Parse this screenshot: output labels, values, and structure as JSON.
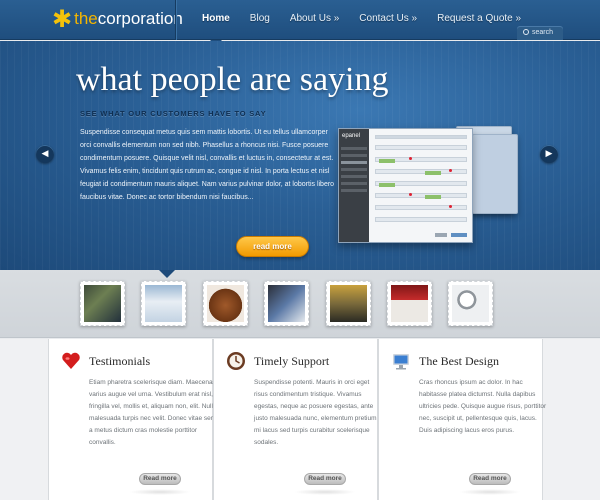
{
  "header": {
    "logo": {
      "prefix": "the",
      "name": "corporation",
      "mark_icon": "star-icon"
    },
    "nav": [
      {
        "label": "Home",
        "active": true
      },
      {
        "label": "Blog",
        "active": false
      },
      {
        "label": "About Us »",
        "active": false
      },
      {
        "label": "Contact Us »",
        "active": false
      },
      {
        "label": "Request a Quote »",
        "active": false
      }
    ],
    "search_label": "search"
  },
  "hero": {
    "title": "what people are saying",
    "subtitle": "SEE WHAT OUR CUSTOMERS HAVE TO SAY",
    "body": "Suspendisse consequat metus quis sem mattis lobortis. Ut eu tellus ullamcorper orci convallis elementum non sed nibh. Phasellus a rhoncus nisi. Fusce posuere condimentum posuere. Quisque velit nisl, convallis et luctus in, consectetur at est. Vivamus felis enim, tincidunt quis rutrum ac, congue id nisl. In porta lectus et nisl feugiat id condimentum mauris aliquet. Nam varius pulvinar dolor, at lobortis libero faucibus vitae. Donec ac tortor bibendum nisi faucibus...",
    "read_more": "read more",
    "prev_icon": "chevron-left-icon",
    "next_icon": "chevron-right-icon",
    "mockup_brand": "epanel"
  },
  "thumbnails": [
    {
      "name": "dark-dashboard"
    },
    {
      "name": "blue-website"
    },
    {
      "name": "briefcase"
    },
    {
      "name": "web-layout"
    },
    {
      "name": "people-walking"
    },
    {
      "name": "red-website"
    },
    {
      "name": "magnifier"
    }
  ],
  "columns": [
    {
      "icon": "heart-icon",
      "title": "Testimonials",
      "text": "Etiam pharetra scelerisque diam. Maecenas varius augue vel urna. Vestibulum erat nisl, fringilla vel, mollis et, aliquam non, elit. Nulla malesuada turpis nec velit. Donec vitae sem a metus dictum cras molestie porttitor convallis.",
      "button": "Read more"
    },
    {
      "icon": "clock-icon",
      "title": "Timely Support",
      "text": "Suspendisse potenti. Mauris in orci eget risus condimentum tristique. Vivamus egestas, neque ac posuere egestas, ante justo malesuada nunc, elementum pretium mi lacus sed turpis curabitur scelerisque sodales.",
      "button": "Read more"
    },
    {
      "icon": "monitor-icon",
      "title": "The Best Design",
      "text": "Cras rhoncus ipsum ac dolor. In hac habitasse platea dictumst. Nulla dapibus ultricies pede. Quisque augue risus, porttitor nec, suscipit ut, pellentesque quis, lacus. Duis adipiscing lacus eros purus.",
      "button": "Read more"
    }
  ],
  "colors": {
    "header_bg": "#1f4e7e",
    "hero_bg": "#2a5f95",
    "accent_orange": "#f29a00",
    "logo_yellow": "#f4b500"
  }
}
